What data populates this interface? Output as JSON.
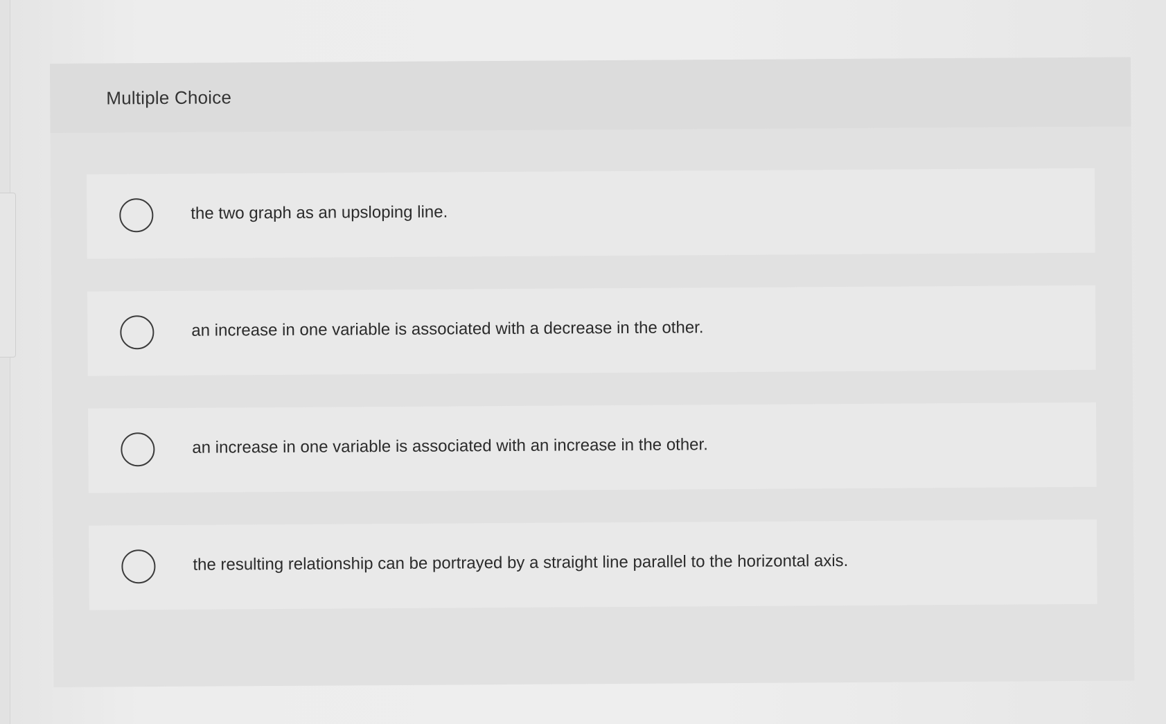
{
  "question": {
    "title": "Multiple Choice",
    "options": [
      {
        "label": "the two graph as an upsloping line.",
        "selected": false
      },
      {
        "label": "an increase in one variable is associated with a decrease in the other.",
        "selected": false
      },
      {
        "label": "an increase in one variable is associated with an increase in the other.",
        "selected": false
      },
      {
        "label": "the resulting relationship can be portrayed by a straight line parallel to the horizontal axis.",
        "selected": false
      }
    ]
  },
  "colors": {
    "page_background": "#eeeeee",
    "card_background": "#e1e1e1",
    "option_background": "#e9e9e9",
    "radio_border": "#3b3b3b",
    "text": "#2b2b2b"
  },
  "icons": {
    "radio": "radio-button-unselected-icon"
  }
}
